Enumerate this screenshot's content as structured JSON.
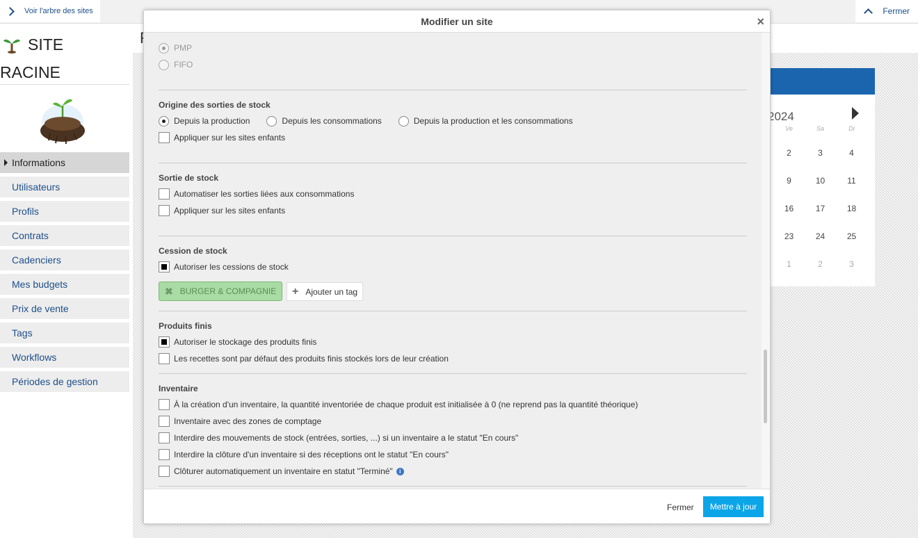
{
  "topbar": {
    "tree_link": "Voir l'arbre des sites",
    "close": "Fermer"
  },
  "sidebar": {
    "site_line1": "SITE",
    "site_line2": "RACINE",
    "items": [
      {
        "label": "Informations"
      },
      {
        "label": "Utilisateurs"
      },
      {
        "label": "Profils"
      },
      {
        "label": "Contrats"
      },
      {
        "label": "Cadenciers"
      },
      {
        "label": "Mes budgets"
      },
      {
        "label": "Prix de vente"
      },
      {
        "label": "Tags"
      },
      {
        "label": "Workflows"
      },
      {
        "label": "Périodes de gestion"
      }
    ]
  },
  "content": {
    "heading_fragment": "F"
  },
  "calendar": {
    "year": "2024",
    "day_headers": [
      "Ve",
      "Sa",
      "Di"
    ],
    "rows": [
      [
        "2",
        "3",
        "4"
      ],
      [
        "9",
        "10",
        "11"
      ],
      [
        "16",
        "17",
        "18"
      ],
      [
        "23",
        "24",
        "25"
      ],
      [
        "1",
        "2",
        "3"
      ]
    ],
    "header_color": "#1b65ae"
  },
  "modal": {
    "title": "Modifier un site",
    "valuation": {
      "pmp": "PMP",
      "fifo": "FIFO"
    },
    "origin": {
      "title": "Origine des sorties de stock",
      "opt1": "Depuis la production",
      "opt2": "Depuis les consommations",
      "opt3": "Depuis la production et les consommations",
      "apply_children": "Appliquer sur les sites enfants"
    },
    "exit": {
      "title": "Sortie de stock",
      "automate": "Automatiser les sorties liées aux consommations",
      "apply_children": "Appliquer sur les sites enfants"
    },
    "cession": {
      "title": "Cession de stock",
      "allow": "Autoriser les cessions de stock",
      "tag": "BURGER & COMPAGNIE",
      "add_tag": "Ajouter un tag"
    },
    "finished": {
      "title": "Produits finis",
      "allow_storage": "Autoriser le stockage des produits finis",
      "recipes_default": "Les recettes sont par défaut des produits finis stockés lors de leur création"
    },
    "inventory": {
      "title": "Inventaire",
      "opt1": "À la création d'un inventaire, la quantité inventoriée de chaque produit est initialisée à 0 (ne reprend pas la quantité théorique)",
      "opt2": "Inventaire avec des zones de comptage",
      "opt3": "Interdire des mouvements de stock (entrées, sorties, ...) si un inventaire a le statut \"En cours\"",
      "opt4": "Interdire la clôture d'un inventaire si des réceptions ont le statut \"En cours\"",
      "opt5": "Clôturer automatiquement un inventaire en statut \"Terminé\""
    },
    "footer": {
      "close": "Fermer",
      "update": "Mettre à jour"
    },
    "accent_color": "#0ca5e8"
  }
}
